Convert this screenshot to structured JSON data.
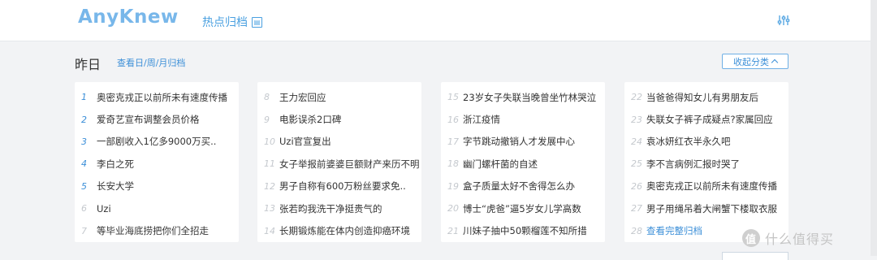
{
  "header": {
    "logo_main": "AnyK",
    "logo_tail": "new",
    "archive_title": "热点归档",
    "settings_icon": "sliders-icon"
  },
  "section": {
    "title": "昨日",
    "view_link": "查看日/周/月归档",
    "collapse_label": "收起分类"
  },
  "columns": [
    {
      "items": [
        {
          "num": "1",
          "title": "奥密克戎正以前所未有速度传播"
        },
        {
          "num": "2",
          "title": "爱奇艺宣布调整会员价格"
        },
        {
          "num": "3",
          "title": "一部剧收入1亿多9000万买.."
        },
        {
          "num": "4",
          "title": "李白之死"
        },
        {
          "num": "5",
          "title": "长安大学"
        },
        {
          "num": "6",
          "title": "Uzi"
        },
        {
          "num": "7",
          "title": "等毕业海底捞把你们全招走"
        }
      ]
    },
    {
      "items": [
        {
          "num": "8",
          "title": "王力宏回应"
        },
        {
          "num": "9",
          "title": "电影误杀2口碑"
        },
        {
          "num": "10",
          "title": "Uzi官宣复出"
        },
        {
          "num": "11",
          "title": "女子举报前婆婆巨额财产来历不明"
        },
        {
          "num": "12",
          "title": "男子自称有600万粉丝要求免.."
        },
        {
          "num": "13",
          "title": "张若昀我洗干净挺贵气的"
        },
        {
          "num": "14",
          "title": "长期锻炼能在体内创造抑癌环境"
        }
      ]
    },
    {
      "items": [
        {
          "num": "15",
          "title": "23岁女子失联当晚曾坐竹林哭泣"
        },
        {
          "num": "16",
          "title": "浙江疫情"
        },
        {
          "num": "17",
          "title": "字节跳动撤销人才发展中心"
        },
        {
          "num": "18",
          "title": "幽门螺杆菌的自述"
        },
        {
          "num": "19",
          "title": "盒子质量太好不舍得怎么办"
        },
        {
          "num": "20",
          "title": "博士“虎爸”逼5岁女儿学高数"
        },
        {
          "num": "21",
          "title": "川妹子抽中50颗榴莲不知所措"
        }
      ]
    },
    {
      "items": [
        {
          "num": "22",
          "title": "当爸爸得知女儿有男朋友后"
        },
        {
          "num": "23",
          "title": "失联女子裤子成疑点?家属回应"
        },
        {
          "num": "24",
          "title": "袁冰妍红衣半永久吧"
        },
        {
          "num": "25",
          "title": "李不言病例汇报时哭了"
        },
        {
          "num": "26",
          "title": "奥密克戎正以前所未有速度传播"
        },
        {
          "num": "27",
          "title": "男子用绳吊着大闸蟹下楼取衣服"
        },
        {
          "num": "28",
          "title": "查看完整归档",
          "link": true
        }
      ]
    }
  ],
  "watermark": {
    "badge": "值",
    "text": "什么值得买"
  },
  "colors": {
    "accent": "#3c8fd8",
    "rank_top": "#3c8fd8",
    "rank_rest": "#c5c9ce"
  }
}
